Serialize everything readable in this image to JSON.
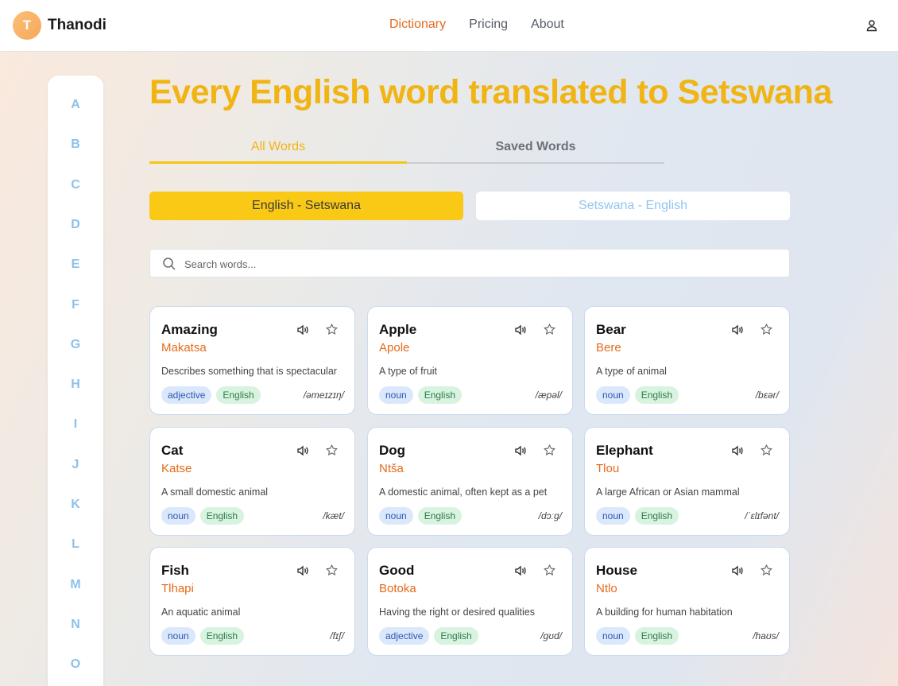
{
  "header": {
    "logo_letter": "T",
    "app_name": "Thanodi",
    "nav": [
      {
        "label": "Dictionary",
        "active": true
      },
      {
        "label": "Pricing",
        "active": false
      },
      {
        "label": "About",
        "active": false
      }
    ],
    "user_icon": "user-icon"
  },
  "alphabet": [
    "A",
    "B",
    "C",
    "D",
    "E",
    "F",
    "G",
    "H",
    "I",
    "J",
    "K",
    "L",
    "M",
    "N",
    "O"
  ],
  "main": {
    "title": "Every English word translated to Setswana",
    "tabs": [
      {
        "label": "All Words",
        "active": true
      },
      {
        "label": "Saved Words",
        "active": false
      }
    ],
    "direction": {
      "active_label": "English - Setswana",
      "inactive_label": "Setswana - English"
    },
    "search": {
      "placeholder": "Search words..."
    }
  },
  "words": [
    {
      "word": "Amazing",
      "translation": "Makatsa",
      "description": "Describes something that is spectacular",
      "pos": "adjective",
      "lang": "English",
      "phonetic": "/əmeɪzɪŋ/"
    },
    {
      "word": "Apple",
      "translation": "Apole",
      "description": "A type of fruit",
      "pos": "noun",
      "lang": "English",
      "phonetic": "/æpəl/"
    },
    {
      "word": "Bear",
      "translation": "Bere",
      "description": "A type of animal",
      "pos": "noun",
      "lang": "English",
      "phonetic": "/bɛər/"
    },
    {
      "word": "Cat",
      "translation": "Katse",
      "description": "A small domestic animal",
      "pos": "noun",
      "lang": "English",
      "phonetic": "/kæt/"
    },
    {
      "word": "Dog",
      "translation": "Ntša",
      "description": "A domestic animal, often kept as a pet",
      "pos": "noun",
      "lang": "English",
      "phonetic": "/dɔːɡ/"
    },
    {
      "word": "Elephant",
      "translation": "Tlou",
      "description": "A large African or Asian mammal",
      "pos": "noun",
      "lang": "English",
      "phonetic": "/ˈɛlɪfənt/"
    },
    {
      "word": "Fish",
      "translation": "Tlhapi",
      "description": "An aquatic animal",
      "pos": "noun",
      "lang": "English",
      "phonetic": "/fɪʃ/"
    },
    {
      "word": "Good",
      "translation": "Botoka",
      "description": "Having the right or desired qualities",
      "pos": "adjective",
      "lang": "English",
      "phonetic": "/ɡʊd/"
    },
    {
      "word": "House",
      "translation": "Ntlo",
      "description": "A building for human habitation",
      "pos": "noun",
      "lang": "English",
      "phonetic": "/haʊs/"
    }
  ],
  "colors": {
    "accent": "#f0b414",
    "translation": "#e46a1a",
    "alphabet": "#8ec1ea"
  }
}
